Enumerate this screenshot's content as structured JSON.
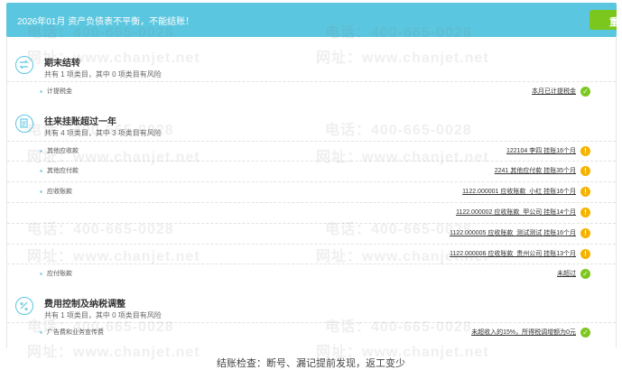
{
  "banner": {
    "text": "2026年01月 资产负债表不平衡，不能结账！",
    "button_label": "重"
  },
  "sections": [
    {
      "title": "期末结转",
      "summary": "共有 1 项类目，其中 0 项类目有风险",
      "rows": [
        {
          "label": "计提税金",
          "detail": "本月已计提税金",
          "status": "ok"
        }
      ]
    },
    {
      "title": "往来挂账超过一年",
      "summary": "共有 4 项类目，其中 3 项类目有风险",
      "rows": [
        {
          "label": "其他应收款",
          "detail": "122104 李四 挂账16个月",
          "status": "warn"
        },
        {
          "label": "其他应付款",
          "detail": "2241 其他应付款 挂账35个月",
          "status": "warn"
        },
        {
          "label": "应收账款",
          "detail": "1122.000001 应收账款_小红 挂账16个月",
          "status": "warn"
        },
        {
          "label": "",
          "detail": "1122.000002 应收账款_甲公司 挂账14个月",
          "status": "warn"
        },
        {
          "label": "",
          "detail": "1122.000005 应收账款_测试测试 挂账16个月",
          "status": "warn"
        },
        {
          "label": "",
          "detail": "1122.000006 应收账款_贵州公司 挂账13个月",
          "status": "warn"
        },
        {
          "label": "应付账款",
          "detail": "未超过",
          "status": "ok"
        }
      ]
    },
    {
      "title": "费用控制及纳税调整",
      "summary": "共有 1 项类目，其中 0 项类目有风险",
      "rows": [
        {
          "label": "广告费和业务宣传费",
          "detail": "未超收入的15%，所得税调增额为0元",
          "status": "ok"
        }
      ]
    }
  ],
  "watermarks": {
    "phone": "电话：400-665-0028",
    "site": "网址：www.chanjet.net"
  },
  "caption": "结账检查：断号、漏记提前发现，返工变少"
}
